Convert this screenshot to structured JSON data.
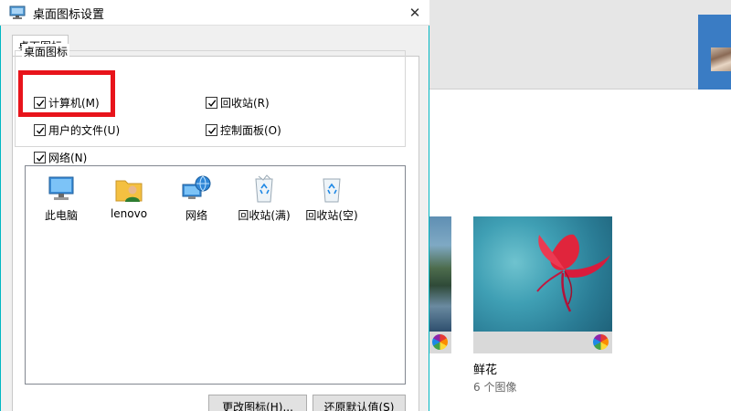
{
  "dialog": {
    "title": "桌面图标设置",
    "tab_label": "桌面图标",
    "group_label": "桌面图标",
    "checkboxes": [
      {
        "label": "计算机(M)",
        "checked": true
      },
      {
        "label": "回收站(R)",
        "checked": true
      },
      {
        "label": "用户的文件(U)",
        "checked": true
      },
      {
        "label": "控制面板(O)",
        "checked": true
      },
      {
        "label": "网络(N)",
        "checked": true
      }
    ],
    "icons": [
      {
        "label": "此电脑",
        "icon": "computer-icon"
      },
      {
        "label": "lenovo",
        "icon": "user-folder-icon"
      },
      {
        "label": "网络",
        "icon": "network-icon"
      },
      {
        "label": "回收站(满)",
        "icon": "recycle-bin-full-icon"
      },
      {
        "label": "回收站(空)",
        "icon": "recycle-bin-empty-icon"
      }
    ],
    "buttons": {
      "change_icon": "更改图标(H)...",
      "restore_default": "还原默认值(S)"
    }
  },
  "background": {
    "album": {
      "title": "鲜花",
      "count": "6 个图像"
    }
  },
  "colors": {
    "accent_border": "#00b7c3",
    "highlight": "#e8141b"
  }
}
